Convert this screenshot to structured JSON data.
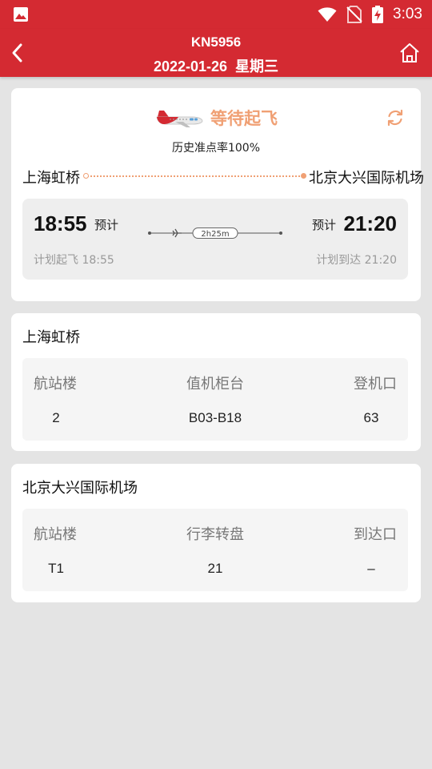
{
  "status_bar": {
    "time": "3:03"
  },
  "header": {
    "flight_no": "KN5956",
    "date": "2022-01-26",
    "weekday": "星期三"
  },
  "flight": {
    "status": "等待起飞",
    "ontime_rate": "历史准点率100%",
    "origin": "上海虹桥",
    "destination": "北京大兴国际机场",
    "dep_time": "18:55",
    "dep_est_label": "预计",
    "arr_time": "21:20",
    "arr_est_label": "预计",
    "duration": "2h25m",
    "dep_plan_label": "计划起飞",
    "dep_plan_time": "18:55",
    "arr_plan_label": "计划到达",
    "arr_plan_time": "21:20",
    "accent_color": "#f0a074"
  },
  "origin_card": {
    "title": "上海虹桥",
    "headers": [
      "航站楼",
      "值机柜台",
      "登机口"
    ],
    "values": [
      "2",
      "B03-B18",
      "63"
    ]
  },
  "destination_card": {
    "title": "北京大兴国际机场",
    "headers": [
      "航站楼",
      "行李转盘",
      "到达口"
    ],
    "values": [
      "T1",
      "21",
      "–"
    ]
  },
  "theme": {
    "brand_red": "#d42a32",
    "background": "#e4e4e4"
  }
}
